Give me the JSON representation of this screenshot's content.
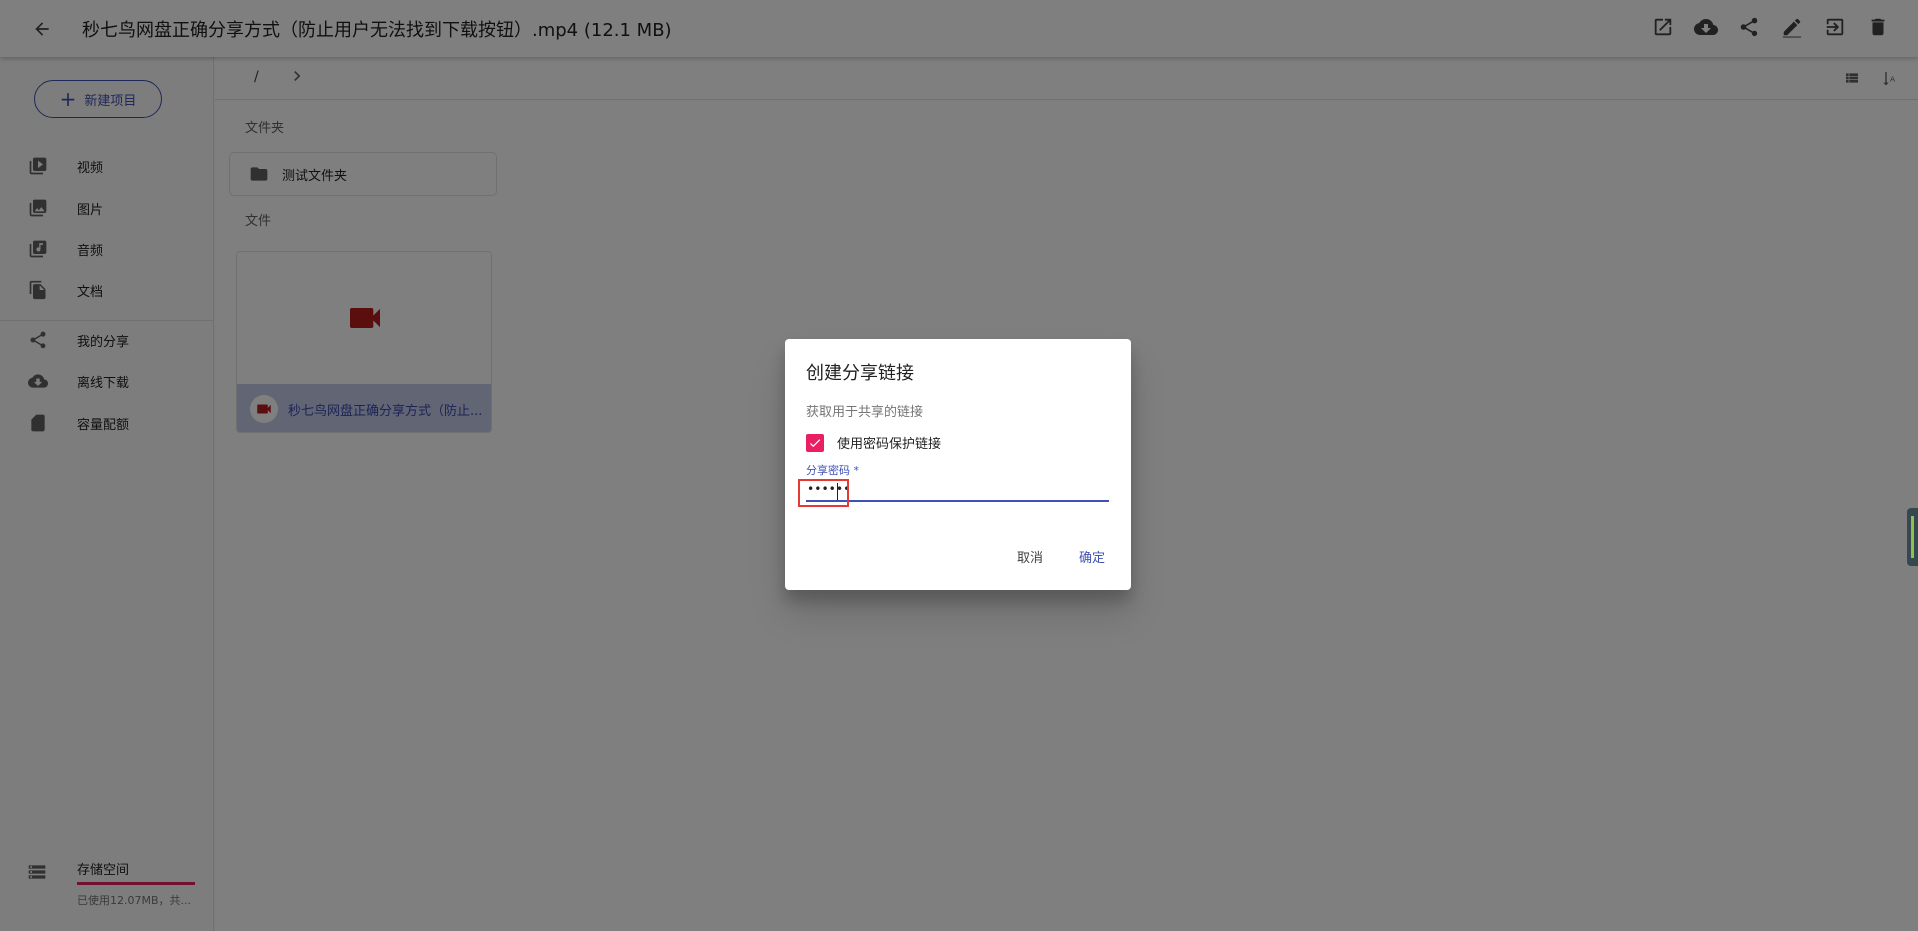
{
  "topbar": {
    "title": "秒七鸟网盘正确分享方式（防止用户无法找到下载按钮）.mp4 (12.1 MB)",
    "actions": [
      "open-in-new-icon",
      "cloud-download-icon",
      "share-icon",
      "edit-icon",
      "move-icon",
      "delete-icon"
    ]
  },
  "sidebar": {
    "new_button": "新建项目",
    "items": [
      {
        "label": "视频",
        "icon": "video-library-icon"
      },
      {
        "label": "图片",
        "icon": "photo-library-icon"
      },
      {
        "label": "音频",
        "icon": "library-music-icon"
      },
      {
        "label": "文档",
        "icon": "file-copy-icon"
      },
      {
        "label": "我的分享",
        "icon": "share-icon"
      },
      {
        "label": "离线下载",
        "icon": "cloud-download-icon"
      },
      {
        "label": "容量配额",
        "icon": "sd-card-icon"
      }
    ],
    "storage": {
      "label": "存储空间",
      "used_text": "已使用12.07MB，共..."
    }
  },
  "main": {
    "breadcrumb_root": "/",
    "folders_label": "文件夹",
    "folder_name": "测试文件夹",
    "files_label": "文件",
    "file_name": "秒七鸟网盘正确分享方式（防止..."
  },
  "dialog": {
    "title": "创建分享链接",
    "description": "获取用于共享的链接",
    "checkbox_label": "使用密码保护链接",
    "checkbox_checked": true,
    "field_label": "分享密码 *",
    "field_value": "••••••",
    "cancel_label": "取消",
    "ok_label": "确定"
  },
  "colors": {
    "primary": "#3f51b5",
    "accent": "#e91e63",
    "video_red": "#b71c1c",
    "highlight": "#e53935"
  }
}
